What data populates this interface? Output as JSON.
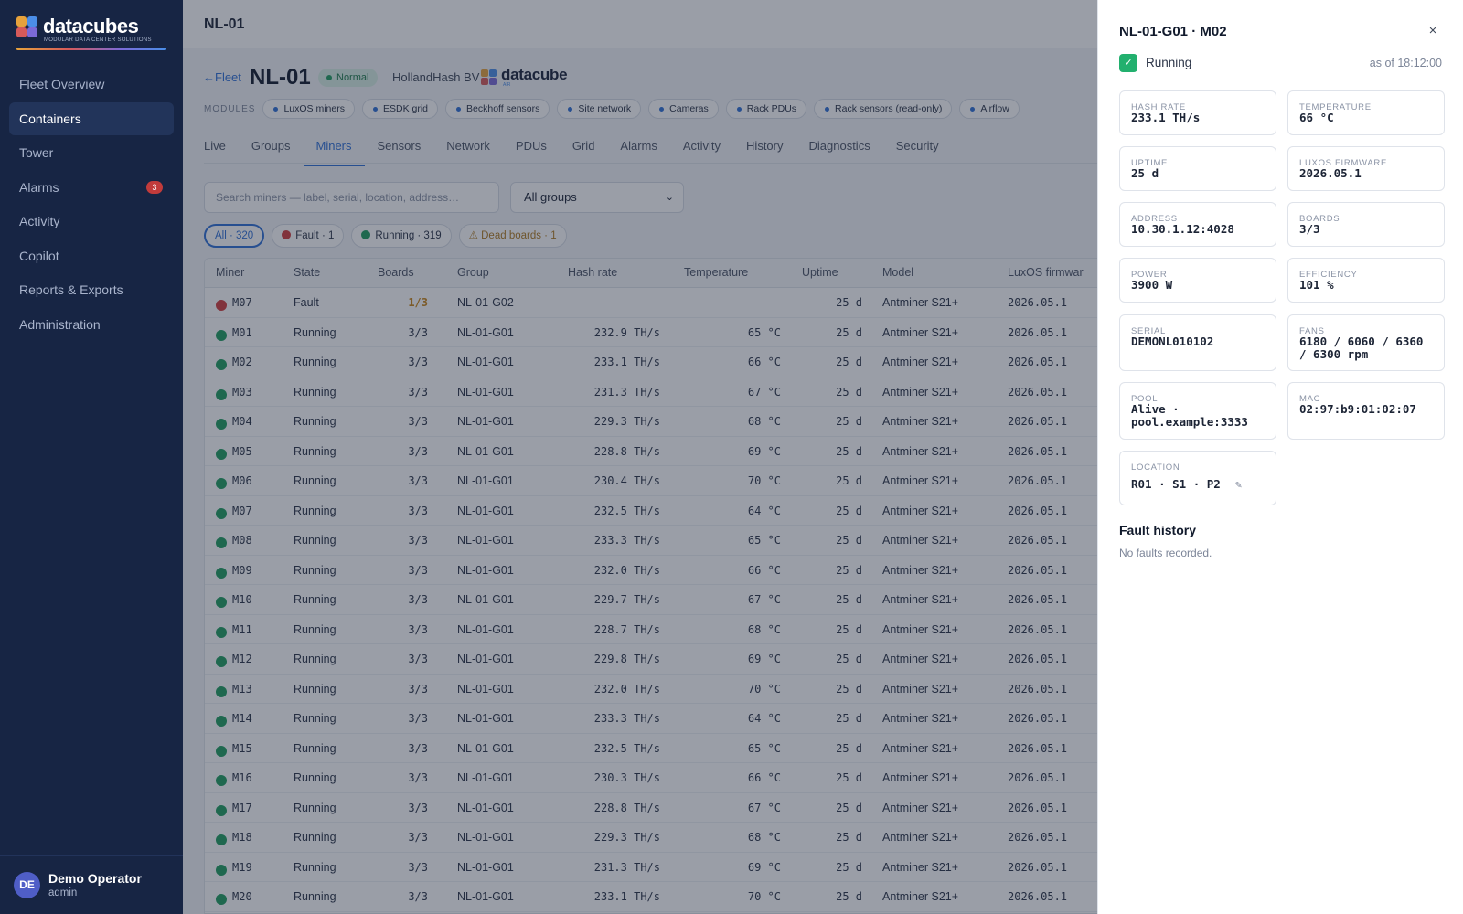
{
  "app": {
    "logo_text": "datacubes",
    "logo_subtitle": "MODULAR DATA CENTER SOLUTIONS",
    "colors": {
      "sidebar": "#172544",
      "accent": "#2f6fd6",
      "running": "#1f9d5f",
      "fault": "#d23c3c",
      "warn": "#c9861a"
    }
  },
  "sidebar": {
    "items": [
      {
        "label": "Fleet Overview"
      },
      {
        "label": "Containers"
      },
      {
        "label": "Tower"
      },
      {
        "label": "Alarms",
        "badge": "3"
      },
      {
        "label": "Activity"
      },
      {
        "label": "Copilot"
      },
      {
        "label": "Reports & Exports"
      },
      {
        "label": "Administration"
      }
    ],
    "user": {
      "initials": "DE",
      "name": "Demo Operator",
      "role": "admin"
    }
  },
  "topbar": {
    "title": "NL-01"
  },
  "header": {
    "back": "←Fleet",
    "title": "NL-01",
    "status": "Normal",
    "owner": "HollandHash BV",
    "brand": {
      "name": "datacube",
      "sub": "AIR"
    }
  },
  "modules": {
    "label": "MODULES",
    "items": [
      "LuxOS miners",
      "ESDK grid",
      "Beckhoff sensors",
      "Site network",
      "Cameras",
      "Rack PDUs",
      "Rack sensors (read-only)",
      "Airflow"
    ]
  },
  "tabs": [
    "Live",
    "Groups",
    "Miners",
    "Sensors",
    "Network",
    "PDUs",
    "Grid",
    "Alarms",
    "Activity",
    "History",
    "Diagnostics",
    "Security"
  ],
  "search": {
    "placeholder": "Search miners — label, serial, location, address…",
    "value": ""
  },
  "group_select": {
    "value": "All groups"
  },
  "filters": [
    {
      "label": "All · 320",
      "icon": "none"
    },
    {
      "label": "Fault · 1",
      "icon": "fault-dot"
    },
    {
      "label": "Running · 319",
      "icon": "running-dot"
    },
    {
      "label": "⚠ Dead boards · 1",
      "icon": "warning-icon"
    }
  ],
  "table": {
    "columns": [
      "Miner",
      "State",
      "Boards",
      "Group",
      "Hash rate",
      "Temperature",
      "Uptime",
      "Model",
      "LuxOS firmwar"
    ],
    "rows": [
      {
        "miner": "M07",
        "state": "Fault",
        "boards": "1/3",
        "group": "NL-01-G02",
        "hash": "—",
        "temp": "—",
        "uptime": "25 d",
        "model": "Antminer S21+",
        "fw": "2026.05.1"
      },
      {
        "miner": "M01",
        "state": "Running",
        "boards": "3/3",
        "group": "NL-01-G01",
        "hash": "232.9 TH/s",
        "temp": "65 °C",
        "uptime": "25 d",
        "model": "Antminer S21+",
        "fw": "2026.05.1"
      },
      {
        "miner": "M02",
        "state": "Running",
        "boards": "3/3",
        "group": "NL-01-G01",
        "hash": "233.1 TH/s",
        "temp": "66 °C",
        "uptime": "25 d",
        "model": "Antminer S21+",
        "fw": "2026.05.1"
      },
      {
        "miner": "M03",
        "state": "Running",
        "boards": "3/3",
        "group": "NL-01-G01",
        "hash": "231.3 TH/s",
        "temp": "67 °C",
        "uptime": "25 d",
        "model": "Antminer S21+",
        "fw": "2026.05.1"
      },
      {
        "miner": "M04",
        "state": "Running",
        "boards": "3/3",
        "group": "NL-01-G01",
        "hash": "229.3 TH/s",
        "temp": "68 °C",
        "uptime": "25 d",
        "model": "Antminer S21+",
        "fw": "2026.05.1"
      },
      {
        "miner": "M05",
        "state": "Running",
        "boards": "3/3",
        "group": "NL-01-G01",
        "hash": "228.8 TH/s",
        "temp": "69 °C",
        "uptime": "25 d",
        "model": "Antminer S21+",
        "fw": "2026.05.1"
      },
      {
        "miner": "M06",
        "state": "Running",
        "boards": "3/3",
        "group": "NL-01-G01",
        "hash": "230.4 TH/s",
        "temp": "70 °C",
        "uptime": "25 d",
        "model": "Antminer S21+",
        "fw": "2026.05.1"
      },
      {
        "miner": "M07",
        "state": "Running",
        "boards": "3/3",
        "group": "NL-01-G01",
        "hash": "232.5 TH/s",
        "temp": "64 °C",
        "uptime": "25 d",
        "model": "Antminer S21+",
        "fw": "2026.05.1"
      },
      {
        "miner": "M08",
        "state": "Running",
        "boards": "3/3",
        "group": "NL-01-G01",
        "hash": "233.3 TH/s",
        "temp": "65 °C",
        "uptime": "25 d",
        "model": "Antminer S21+",
        "fw": "2026.05.1"
      },
      {
        "miner": "M09",
        "state": "Running",
        "boards": "3/3",
        "group": "NL-01-G01",
        "hash": "232.0 TH/s",
        "temp": "66 °C",
        "uptime": "25 d",
        "model": "Antminer S21+",
        "fw": "2026.05.1"
      },
      {
        "miner": "M10",
        "state": "Running",
        "boards": "3/3",
        "group": "NL-01-G01",
        "hash": "229.7 TH/s",
        "temp": "67 °C",
        "uptime": "25 d",
        "model": "Antminer S21+",
        "fw": "2026.05.1"
      },
      {
        "miner": "M11",
        "state": "Running",
        "boards": "3/3",
        "group": "NL-01-G01",
        "hash": "228.7 TH/s",
        "temp": "68 °C",
        "uptime": "25 d",
        "model": "Antminer S21+",
        "fw": "2026.05.1"
      },
      {
        "miner": "M12",
        "state": "Running",
        "boards": "3/3",
        "group": "NL-01-G01",
        "hash": "229.8 TH/s",
        "temp": "69 °C",
        "uptime": "25 d",
        "model": "Antminer S21+",
        "fw": "2026.05.1"
      },
      {
        "miner": "M13",
        "state": "Running",
        "boards": "3/3",
        "group": "NL-01-G01",
        "hash": "232.0 TH/s",
        "temp": "70 °C",
        "uptime": "25 d",
        "model": "Antminer S21+",
        "fw": "2026.05.1"
      },
      {
        "miner": "M14",
        "state": "Running",
        "boards": "3/3",
        "group": "NL-01-G01",
        "hash": "233.3 TH/s",
        "temp": "64 °C",
        "uptime": "25 d",
        "model": "Antminer S21+",
        "fw": "2026.05.1"
      },
      {
        "miner": "M15",
        "state": "Running",
        "boards": "3/3",
        "group": "NL-01-G01",
        "hash": "232.5 TH/s",
        "temp": "65 °C",
        "uptime": "25 d",
        "model": "Antminer S21+",
        "fw": "2026.05.1"
      },
      {
        "miner": "M16",
        "state": "Running",
        "boards": "3/3",
        "group": "NL-01-G01",
        "hash": "230.3 TH/s",
        "temp": "66 °C",
        "uptime": "25 d",
        "model": "Antminer S21+",
        "fw": "2026.05.1"
      },
      {
        "miner": "M17",
        "state": "Running",
        "boards": "3/3",
        "group": "NL-01-G01",
        "hash": "228.8 TH/s",
        "temp": "67 °C",
        "uptime": "25 d",
        "model": "Antminer S21+",
        "fw": "2026.05.1"
      },
      {
        "miner": "M18",
        "state": "Running",
        "boards": "3/3",
        "group": "NL-01-G01",
        "hash": "229.3 TH/s",
        "temp": "68 °C",
        "uptime": "25 d",
        "model": "Antminer S21+",
        "fw": "2026.05.1"
      },
      {
        "miner": "M19",
        "state": "Running",
        "boards": "3/3",
        "group": "NL-01-G01",
        "hash": "231.3 TH/s",
        "temp": "69 °C",
        "uptime": "25 d",
        "model": "Antminer S21+",
        "fw": "2026.05.1"
      },
      {
        "miner": "M20",
        "state": "Running",
        "boards": "3/3",
        "group": "NL-01-G01",
        "hash": "233.1 TH/s",
        "temp": "70 °C",
        "uptime": "25 d",
        "model": "Antminer S21+",
        "fw": "2026.05.1"
      }
    ]
  },
  "drawer": {
    "title": "NL-01-G01 · M02",
    "close": "×",
    "state": "Running",
    "state_icon": "check-icon",
    "as_of": "as of 18:12:00",
    "cards": [
      {
        "label": "HASH RATE",
        "value": "233.1 TH/s"
      },
      {
        "label": "TEMPERATURE",
        "value": "66 °C"
      },
      {
        "label": "UPTIME",
        "value": "25 d"
      },
      {
        "label": "LUXOS FIRMWARE",
        "value": "2026.05.1"
      },
      {
        "label": "ADDRESS",
        "value": "10.30.1.12:4028"
      },
      {
        "label": "BOARDS",
        "value": "3/3"
      },
      {
        "label": "POWER",
        "value": "3900 W"
      },
      {
        "label": "EFFICIENCY",
        "value": "101 %"
      },
      {
        "label": "SERIAL",
        "value": "DEMONL010102"
      },
      {
        "label": "FANS",
        "value": "6180 / 6060 / 6360 / 6300 rpm"
      },
      {
        "label": "POOL",
        "value": "Alive · pool.example:3333"
      },
      {
        "label": "MAC",
        "value": "02:97:b9:01:02:07"
      },
      {
        "label": "LOCATION",
        "value": "R01 · S1 · P2"
      }
    ],
    "fault_title": "Fault history",
    "fault_empty": "No faults recorded."
  }
}
